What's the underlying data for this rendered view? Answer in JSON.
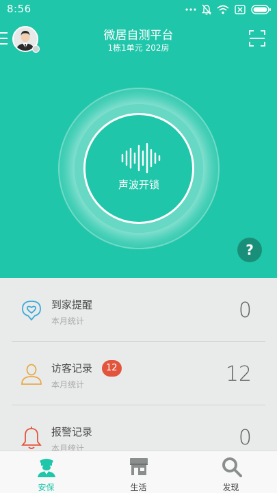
{
  "status_bar": {
    "time": "8:56"
  },
  "header": {
    "title": "微居自测平台",
    "subtitle": "1栋1单元 202房"
  },
  "unlock": {
    "label": "声波开锁"
  },
  "help": {
    "label": "?"
  },
  "records": [
    {
      "title": "到家提醒",
      "subtitle": "本月统计",
      "count": "0",
      "icon": "heart-pin-icon"
    },
    {
      "title": "访客记录",
      "subtitle": "本月统计",
      "count": "12",
      "badge": "12",
      "icon": "visitor-person-icon"
    },
    {
      "title": "报警记录",
      "subtitle": "本月统计",
      "count": "0",
      "icon": "alarm-bell-icon"
    }
  ],
  "tabs": [
    {
      "label": "安保",
      "icon": "guard-icon",
      "active": true
    },
    {
      "label": "生活",
      "icon": "store-icon",
      "active": false
    },
    {
      "label": "发现",
      "icon": "discover-search-icon",
      "active": false
    }
  ],
  "colors": {
    "accent": "#1fc6a9",
    "help_bg": "#198f7a",
    "badge": "#e2553d",
    "visitor_icon": "#e8a94a",
    "alarm_icon": "#e2553d",
    "home_icon": "#3aa9d8"
  }
}
